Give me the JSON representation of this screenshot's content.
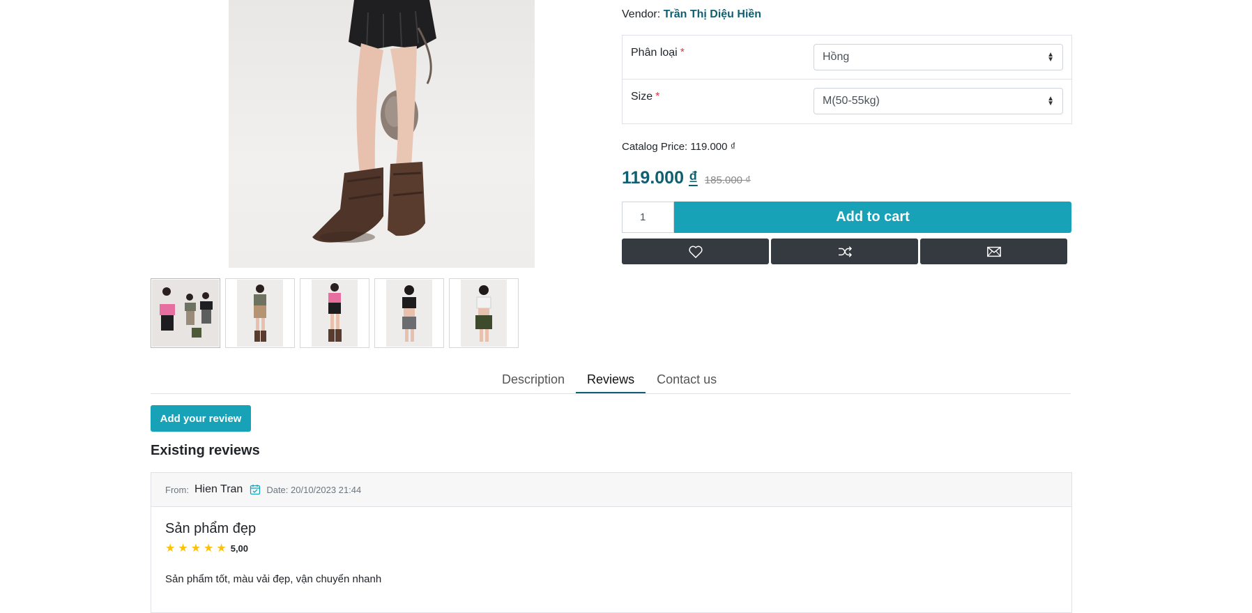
{
  "vendor": {
    "label": "Vendor:",
    "name": "Trần Thị Diệu Hiền"
  },
  "variants": [
    {
      "label": "Phân loại",
      "required_mark": "*",
      "selected": "Hồng"
    },
    {
      "label": "Size",
      "required_mark": "*",
      "selected": "M(50-55kg)"
    }
  ],
  "catalog_price": "Catalog Price: 119.000 ₫",
  "price": {
    "current": "119.000",
    "currency": "₫",
    "old": "185.000 ₫"
  },
  "cart": {
    "quantity": "1",
    "add_label": "Add to cart"
  },
  "actions": [
    "heart-icon",
    "shuffle-icon",
    "envelope-icon"
  ],
  "gallery": {
    "thumbnail_count": 5,
    "active_index": 0
  },
  "tabs": [
    {
      "label": "Description",
      "active": false
    },
    {
      "label": "Reviews",
      "active": true
    },
    {
      "label": "Contact us",
      "active": false
    }
  ],
  "reviews": {
    "add_label": "Add your review",
    "section_title": "Existing reviews",
    "items": [
      {
        "from_label": "From:",
        "author": "Hien Tran",
        "date": "Date: 20/10/2023 21:44",
        "title": "Sản phẩm đẹp",
        "stars": 5,
        "rating": "5,00",
        "text": "Sản phẩm tốt, màu vải đẹp, vận chuyển nhanh"
      }
    ]
  },
  "colors": {
    "accent": "#17a2b8",
    "price": "#0f5f71",
    "dark_button": "#343a40",
    "star": "#ffc107"
  }
}
